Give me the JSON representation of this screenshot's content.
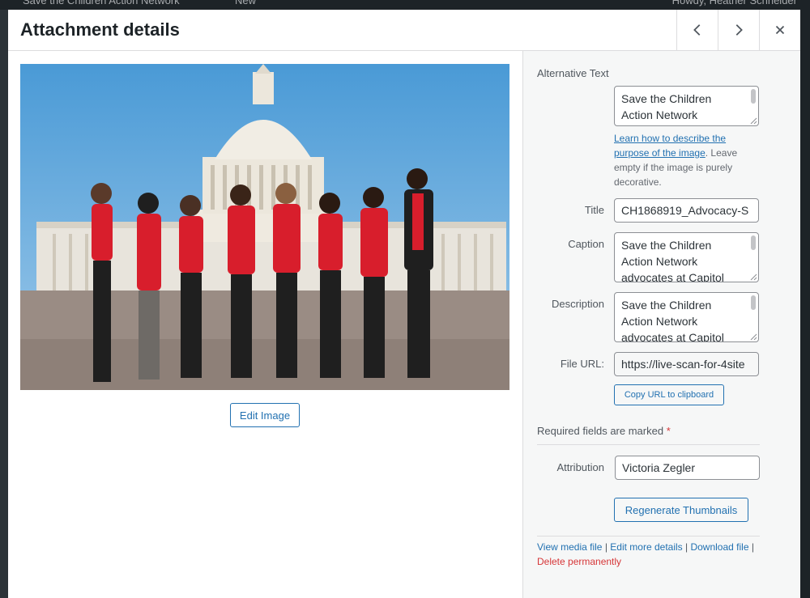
{
  "adminbar": {
    "site_name": "Save the Children Action Network",
    "new_label": "New",
    "howdy": "Howdy, Heather Schneider"
  },
  "modal": {
    "title": "Attachment details",
    "edit_image_label": "Edit Image"
  },
  "fields": {
    "alt_text_label": "Alternative Text",
    "alt_text_value": "Save the Children Action Network",
    "alt_help_link": "Learn how to describe the purpose of the image",
    "alt_help_rest": ". Leave empty if the image is purely decorative.",
    "title_label": "Title",
    "title_value": "CH1868919_Advocacy-S",
    "caption_label": "Caption",
    "caption_value": "Save the Children Action Network advocates at Capitol",
    "description_label": "Description",
    "description_value": "Save the Children Action Network advocates at Capitol",
    "file_url_label": "File URL:",
    "file_url_value": "https://live-scan-for-4site",
    "copy_url_label": "Copy URL to clipboard",
    "required_text": "Required fields are marked",
    "required_star": "*",
    "attribution_label": "Attribution",
    "attribution_value": "Victoria Zegler",
    "regenerate_label": "Regenerate Thumbnails"
  },
  "links": {
    "view": "View media file",
    "edit": "Edit more details",
    "download": "Download file",
    "delete": "Delete permanently",
    "separator": " | "
  },
  "colors": {
    "accent": "#2271b1",
    "danger": "#d63638",
    "sky": "#5aa6de",
    "shirt": "#d81e2c"
  }
}
